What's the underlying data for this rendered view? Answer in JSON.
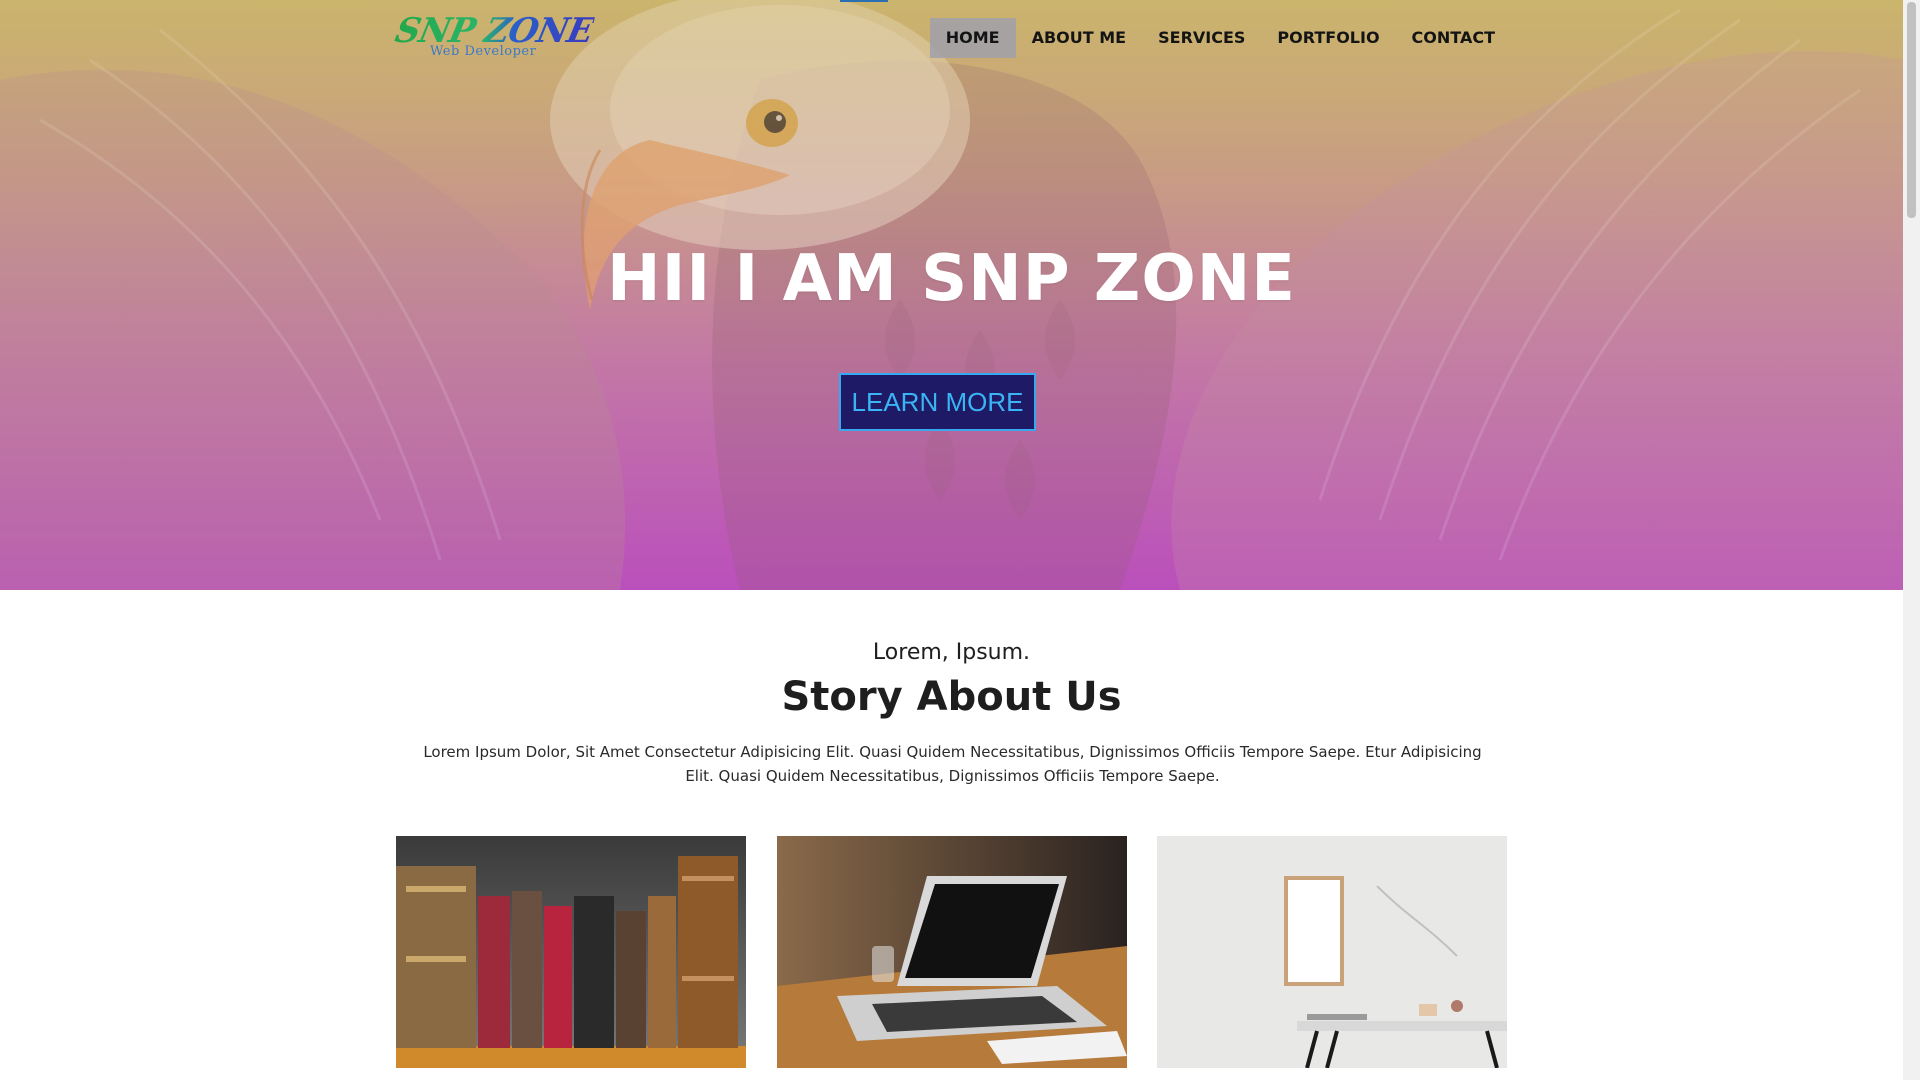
{
  "header": {
    "logo_text": "SNP ZONE",
    "logo_subtitle": "Web Developer",
    "nav": [
      {
        "label": "HOME",
        "active": true
      },
      {
        "label": "ABOUT ME",
        "active": false
      },
      {
        "label": "SERVICES",
        "active": false
      },
      {
        "label": "PORTFOLIO",
        "active": false
      },
      {
        "label": "CONTACT",
        "active": false
      }
    ]
  },
  "hero": {
    "title": "HII I AM SNP ZONE",
    "button_label": "LEARN MORE"
  },
  "story": {
    "kicker": "Lorem, Ipsum.",
    "title": "Story About Us",
    "text": "Lorem Ipsum Dolor, Sit Amet Consectetur Adipisicing Elit. Quasi Quidem Necessitatibus, Dignissimos Officiis Tempore Saepe. Etur Adipisicing Elit. Quasi Quidem Necessitatibus, Dignissimos Officiis Tempore Saepe."
  },
  "colors": {
    "hero_top": "#c8b36e",
    "hero_bottom": "#b84fba",
    "button_bg": "#1e1a66",
    "button_border": "#3aa8f0",
    "button_text": "#3ab4f4",
    "nav_active_bg": "#a0a0aa",
    "logo_green": "#22a84a",
    "logo_blue": "#2a5fc8"
  },
  "icons": {
    "card_1": "old-books-photo",
    "card_2": "laptop-on-desk-photo",
    "card_3": "frame-and-desk-photo",
    "hero_background": "bald-eagle-photo"
  }
}
